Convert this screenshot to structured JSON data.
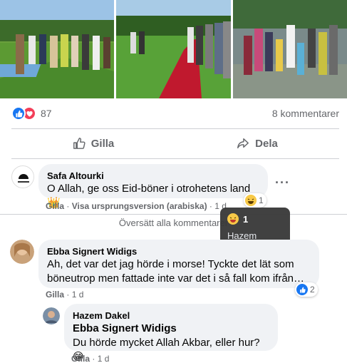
{
  "post": {
    "reaction_count": "87",
    "comment_count_label": "8 kommentarer",
    "actions": {
      "like_label": "Gilla",
      "share_label": "Dela"
    }
  },
  "comments": [
    {
      "author": "Safa Altourki",
      "text": "O Allah, ge oss Eid-böner i otrohetens land 👑",
      "like_label": "Gilla",
      "extra_label": "Visa ursprungsversion (arabiska)",
      "time": "1 d",
      "reaction_count": "1"
    },
    {
      "author": "Ebba Signert Widigs",
      "text": "Ah, det var det jag hörde i morse! Tyckte det lät som böneutrop men fattade inte var det i så fall kom ifrån…",
      "like_label": "Gilla",
      "time": "1 d",
      "reaction_count": "2"
    }
  ],
  "reply": {
    "author": "Hazem Dakel",
    "mention": "Ebba Signert Widigs",
    "text": "Du hörde mycket Allah Akbar, eller hur? 😁",
    "like_label": "Gilla",
    "time": "1 d"
  },
  "translate_all_label": "Översätt alla kommentarer",
  "tooltip": {
    "count": "1",
    "user": "Hazem Dakel"
  },
  "colors": {
    "facebook_blue": "#1877f2",
    "love_red": "#f33e58",
    "bubble_bg": "#f0f2f5",
    "meta_gray": "#65676b"
  }
}
